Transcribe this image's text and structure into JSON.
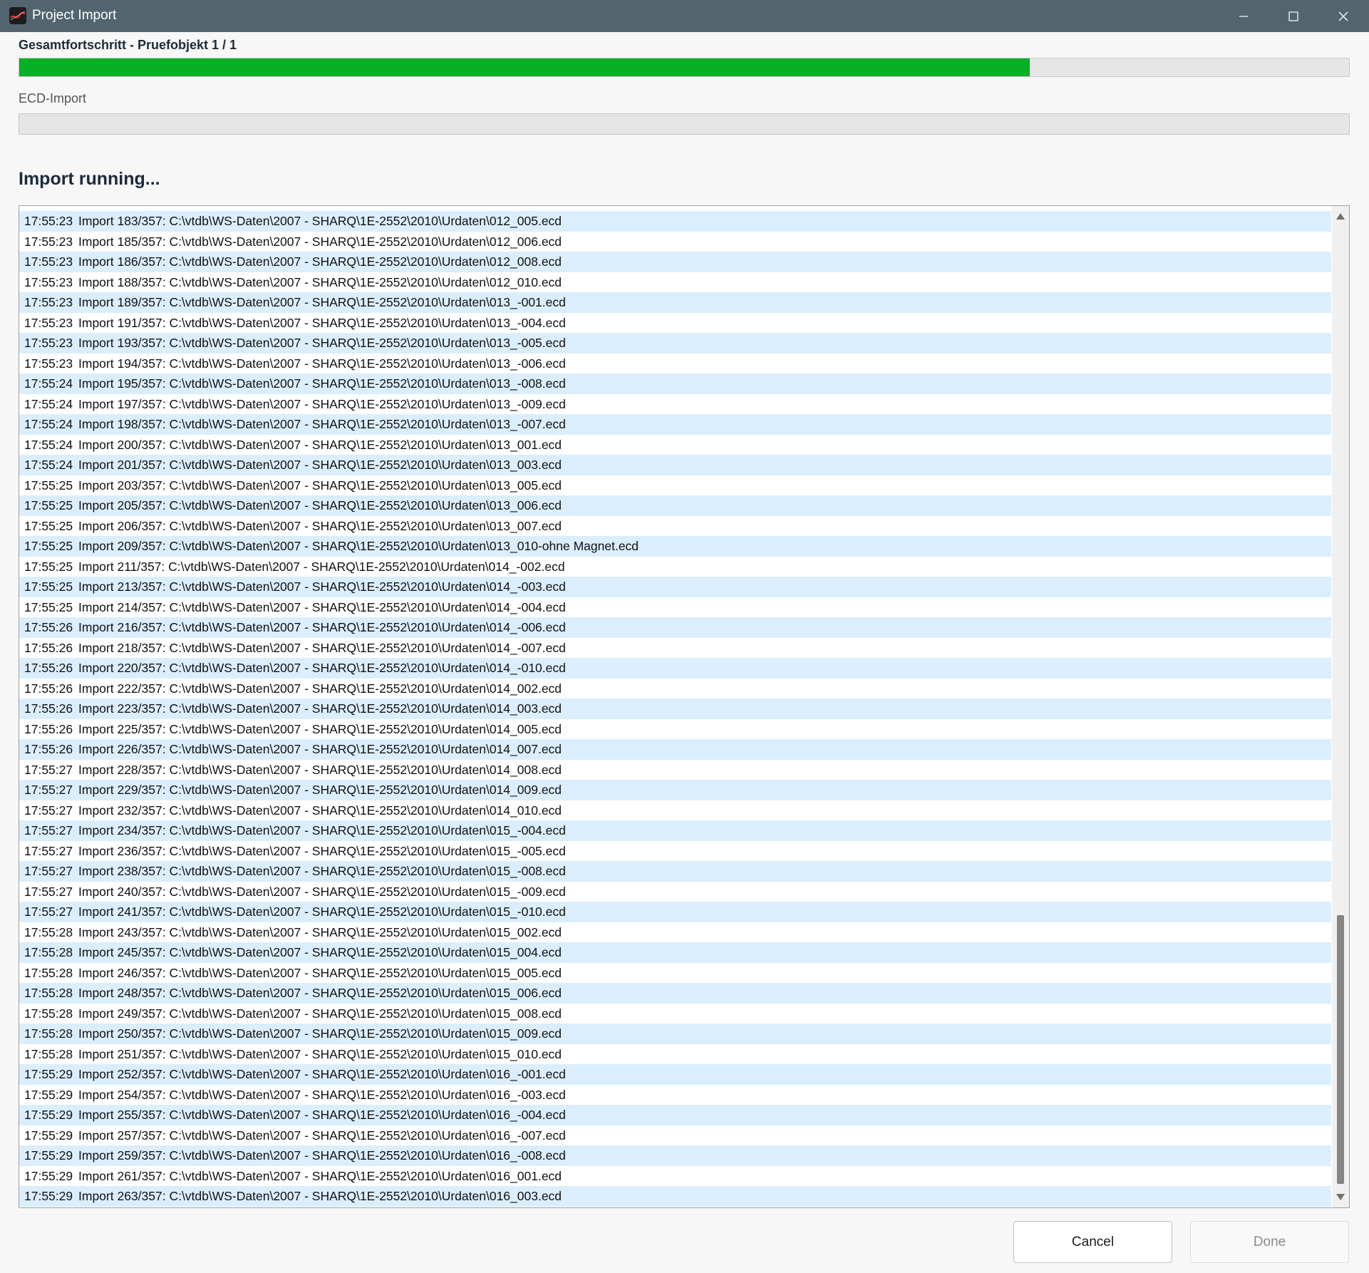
{
  "window": {
    "title": "Project Import",
    "icon": "app-logo-icon",
    "controls": [
      "minimize-icon",
      "maximize-icon",
      "close-icon"
    ]
  },
  "overall": {
    "label": "Gesamtfortschritt - Pruefobjekt 1 / 1",
    "progress_percent": 76,
    "fill_color": "#06b025"
  },
  "ecd": {
    "label": "ECD-Import",
    "progress_percent": 0
  },
  "status": {
    "heading": "Import running..."
  },
  "log": {
    "row_alt_color": "#dbeefd",
    "entries": [
      {
        "time": "17:55:23",
        "text": "Import 183/357: C:\\vtdb\\WS-Daten\\2007 - SHARQ\\1E-2552\\2010\\Urdaten\\012_005.ecd"
      },
      {
        "time": "17:55:23",
        "text": "Import 185/357: C:\\vtdb\\WS-Daten\\2007 - SHARQ\\1E-2552\\2010\\Urdaten\\012_006.ecd"
      },
      {
        "time": "17:55:23",
        "text": "Import 186/357: C:\\vtdb\\WS-Daten\\2007 - SHARQ\\1E-2552\\2010\\Urdaten\\012_008.ecd"
      },
      {
        "time": "17:55:23",
        "text": "Import 188/357: C:\\vtdb\\WS-Daten\\2007 - SHARQ\\1E-2552\\2010\\Urdaten\\012_010.ecd"
      },
      {
        "time": "17:55:23",
        "text": "Import 189/357: C:\\vtdb\\WS-Daten\\2007 - SHARQ\\1E-2552\\2010\\Urdaten\\013_-001.ecd"
      },
      {
        "time": "17:55:23",
        "text": "Import 191/357: C:\\vtdb\\WS-Daten\\2007 - SHARQ\\1E-2552\\2010\\Urdaten\\013_-004.ecd"
      },
      {
        "time": "17:55:23",
        "text": "Import 193/357: C:\\vtdb\\WS-Daten\\2007 - SHARQ\\1E-2552\\2010\\Urdaten\\013_-005.ecd"
      },
      {
        "time": "17:55:23",
        "text": "Import 194/357: C:\\vtdb\\WS-Daten\\2007 - SHARQ\\1E-2552\\2010\\Urdaten\\013_-006.ecd"
      },
      {
        "time": "17:55:24",
        "text": "Import 195/357: C:\\vtdb\\WS-Daten\\2007 - SHARQ\\1E-2552\\2010\\Urdaten\\013_-008.ecd"
      },
      {
        "time": "17:55:24",
        "text": "Import 197/357: C:\\vtdb\\WS-Daten\\2007 - SHARQ\\1E-2552\\2010\\Urdaten\\013_-009.ecd"
      },
      {
        "time": "17:55:24",
        "text": "Import 198/357: C:\\vtdb\\WS-Daten\\2007 - SHARQ\\1E-2552\\2010\\Urdaten\\013_-007.ecd"
      },
      {
        "time": "17:55:24",
        "text": "Import 200/357: C:\\vtdb\\WS-Daten\\2007 - SHARQ\\1E-2552\\2010\\Urdaten\\013_001.ecd"
      },
      {
        "time": "17:55:24",
        "text": "Import 201/357: C:\\vtdb\\WS-Daten\\2007 - SHARQ\\1E-2552\\2010\\Urdaten\\013_003.ecd"
      },
      {
        "time": "17:55:25",
        "text": "Import 203/357: C:\\vtdb\\WS-Daten\\2007 - SHARQ\\1E-2552\\2010\\Urdaten\\013_005.ecd"
      },
      {
        "time": "17:55:25",
        "text": "Import 205/357: C:\\vtdb\\WS-Daten\\2007 - SHARQ\\1E-2552\\2010\\Urdaten\\013_006.ecd"
      },
      {
        "time": "17:55:25",
        "text": "Import 206/357: C:\\vtdb\\WS-Daten\\2007 - SHARQ\\1E-2552\\2010\\Urdaten\\013_007.ecd"
      },
      {
        "time": "17:55:25",
        "text": "Import 209/357: C:\\vtdb\\WS-Daten\\2007 - SHARQ\\1E-2552\\2010\\Urdaten\\013_010-ohne Magnet.ecd"
      },
      {
        "time": "17:55:25",
        "text": "Import 211/357: C:\\vtdb\\WS-Daten\\2007 - SHARQ\\1E-2552\\2010\\Urdaten\\014_-002.ecd"
      },
      {
        "time": "17:55:25",
        "text": "Import 213/357: C:\\vtdb\\WS-Daten\\2007 - SHARQ\\1E-2552\\2010\\Urdaten\\014_-003.ecd"
      },
      {
        "time": "17:55:25",
        "text": "Import 214/357: C:\\vtdb\\WS-Daten\\2007 - SHARQ\\1E-2552\\2010\\Urdaten\\014_-004.ecd"
      },
      {
        "time": "17:55:26",
        "text": "Import 216/357: C:\\vtdb\\WS-Daten\\2007 - SHARQ\\1E-2552\\2010\\Urdaten\\014_-006.ecd"
      },
      {
        "time": "17:55:26",
        "text": "Import 218/357: C:\\vtdb\\WS-Daten\\2007 - SHARQ\\1E-2552\\2010\\Urdaten\\014_-007.ecd"
      },
      {
        "time": "17:55:26",
        "text": "Import 220/357: C:\\vtdb\\WS-Daten\\2007 - SHARQ\\1E-2552\\2010\\Urdaten\\014_-010.ecd"
      },
      {
        "time": "17:55:26",
        "text": "Import 222/357: C:\\vtdb\\WS-Daten\\2007 - SHARQ\\1E-2552\\2010\\Urdaten\\014_002.ecd"
      },
      {
        "time": "17:55:26",
        "text": "Import 223/357: C:\\vtdb\\WS-Daten\\2007 - SHARQ\\1E-2552\\2010\\Urdaten\\014_003.ecd"
      },
      {
        "time": "17:55:26",
        "text": "Import 225/357: C:\\vtdb\\WS-Daten\\2007 - SHARQ\\1E-2552\\2010\\Urdaten\\014_005.ecd"
      },
      {
        "time": "17:55:26",
        "text": "Import 226/357: C:\\vtdb\\WS-Daten\\2007 - SHARQ\\1E-2552\\2010\\Urdaten\\014_007.ecd"
      },
      {
        "time": "17:55:27",
        "text": "Import 228/357: C:\\vtdb\\WS-Daten\\2007 - SHARQ\\1E-2552\\2010\\Urdaten\\014_008.ecd"
      },
      {
        "time": "17:55:27",
        "text": "Import 229/357: C:\\vtdb\\WS-Daten\\2007 - SHARQ\\1E-2552\\2010\\Urdaten\\014_009.ecd"
      },
      {
        "time": "17:55:27",
        "text": "Import 232/357: C:\\vtdb\\WS-Daten\\2007 - SHARQ\\1E-2552\\2010\\Urdaten\\014_010.ecd"
      },
      {
        "time": "17:55:27",
        "text": "Import 234/357: C:\\vtdb\\WS-Daten\\2007 - SHARQ\\1E-2552\\2010\\Urdaten\\015_-004.ecd"
      },
      {
        "time": "17:55:27",
        "text": "Import 236/357: C:\\vtdb\\WS-Daten\\2007 - SHARQ\\1E-2552\\2010\\Urdaten\\015_-005.ecd"
      },
      {
        "time": "17:55:27",
        "text": "Import 238/357: C:\\vtdb\\WS-Daten\\2007 - SHARQ\\1E-2552\\2010\\Urdaten\\015_-008.ecd"
      },
      {
        "time": "17:55:27",
        "text": "Import 240/357: C:\\vtdb\\WS-Daten\\2007 - SHARQ\\1E-2552\\2010\\Urdaten\\015_-009.ecd"
      },
      {
        "time": "17:55:27",
        "text": "Import 241/357: C:\\vtdb\\WS-Daten\\2007 - SHARQ\\1E-2552\\2010\\Urdaten\\015_-010.ecd"
      },
      {
        "time": "17:55:28",
        "text": "Import 243/357: C:\\vtdb\\WS-Daten\\2007 - SHARQ\\1E-2552\\2010\\Urdaten\\015_002.ecd"
      },
      {
        "time": "17:55:28",
        "text": "Import 245/357: C:\\vtdb\\WS-Daten\\2007 - SHARQ\\1E-2552\\2010\\Urdaten\\015_004.ecd"
      },
      {
        "time": "17:55:28",
        "text": "Import 246/357: C:\\vtdb\\WS-Daten\\2007 - SHARQ\\1E-2552\\2010\\Urdaten\\015_005.ecd"
      },
      {
        "time": "17:55:28",
        "text": "Import 248/357: C:\\vtdb\\WS-Daten\\2007 - SHARQ\\1E-2552\\2010\\Urdaten\\015_006.ecd"
      },
      {
        "time": "17:55:28",
        "text": "Import 249/357: C:\\vtdb\\WS-Daten\\2007 - SHARQ\\1E-2552\\2010\\Urdaten\\015_008.ecd"
      },
      {
        "time": "17:55:28",
        "text": "Import 250/357: C:\\vtdb\\WS-Daten\\2007 - SHARQ\\1E-2552\\2010\\Urdaten\\015_009.ecd"
      },
      {
        "time": "17:55:28",
        "text": "Import 251/357: C:\\vtdb\\WS-Daten\\2007 - SHARQ\\1E-2552\\2010\\Urdaten\\015_010.ecd"
      },
      {
        "time": "17:55:29",
        "text": "Import 252/357: C:\\vtdb\\WS-Daten\\2007 - SHARQ\\1E-2552\\2010\\Urdaten\\016_-001.ecd"
      },
      {
        "time": "17:55:29",
        "text": "Import 254/357: C:\\vtdb\\WS-Daten\\2007 - SHARQ\\1E-2552\\2010\\Urdaten\\016_-003.ecd"
      },
      {
        "time": "17:55:29",
        "text": "Import 255/357: C:\\vtdb\\WS-Daten\\2007 - SHARQ\\1E-2552\\2010\\Urdaten\\016_-004.ecd"
      },
      {
        "time": "17:55:29",
        "text": "Import 257/357: C:\\vtdb\\WS-Daten\\2007 - SHARQ\\1E-2552\\2010\\Urdaten\\016_-007.ecd"
      },
      {
        "time": "17:55:29",
        "text": "Import 259/357: C:\\vtdb\\WS-Daten\\2007 - SHARQ\\1E-2552\\2010\\Urdaten\\016_-008.ecd"
      },
      {
        "time": "17:55:29",
        "text": "Import 261/357: C:\\vtdb\\WS-Daten\\2007 - SHARQ\\1E-2552\\2010\\Urdaten\\016_001.ecd"
      },
      {
        "time": "17:55:29",
        "text": "Import 263/357: C:\\vtdb\\WS-Daten\\2007 - SHARQ\\1E-2552\\2010\\Urdaten\\016_003.ecd"
      }
    ]
  },
  "buttons": {
    "cancel": "Cancel",
    "done": "Done"
  }
}
